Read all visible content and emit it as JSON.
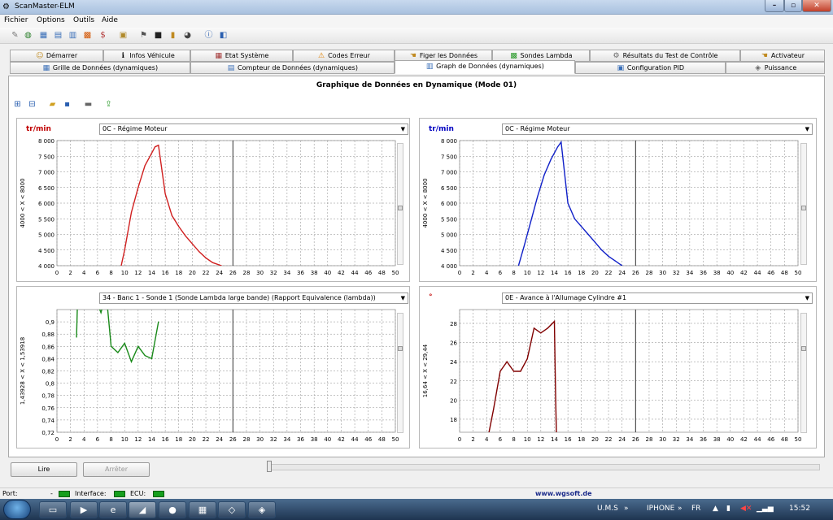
{
  "window": {
    "title": "ScanMaster-ELM",
    "min": "–",
    "max": "▫",
    "close": "✕"
  },
  "menu": [
    "Fichier",
    "Options",
    "Outils",
    "Aide"
  ],
  "tabs_row1": [
    "Démarrer",
    "Infos Véhicule",
    "Etat Système",
    "Codes Erreur",
    "Figer les Données",
    "Sondes Lambda",
    "Résultats du Test de Contrôle",
    "Activateur"
  ],
  "tabs_row2": [
    "Grille de Données (dynamiques)",
    "Compteur de Données (dynamiques)",
    "Graph de Données (dynamiques)",
    "Configuration PID",
    "Puissance"
  ],
  "panel_title": "Graphique de Données en Dynamique (Mode 01)",
  "charts": [
    {
      "unit": "tr/min",
      "pid": "0C - Régime Moteur",
      "range_label": "4000 < X < 8000",
      "color": "#d02020",
      "unit_color": "#c00000",
      "x": [
        9.5,
        10,
        11,
        12,
        13,
        14,
        14.5,
        15,
        16,
        17,
        18,
        19,
        20,
        21,
        22,
        23,
        24.3
      ],
      "y": [
        4000,
        4500,
        5700,
        6500,
        7200,
        7600,
        7800,
        7850,
        6300,
        5600,
        5250,
        4950,
        4700,
        4450,
        4250,
        4100,
        4000
      ]
    },
    {
      "unit": "tr/min",
      "pid": "0C - Régime Moteur",
      "range_label": "4000 < X < 8000",
      "color": "#1020c8",
      "unit_color": "#0000c0",
      "x": [
        8.7,
        9.5,
        10.5,
        11.5,
        12.5,
        13.5,
        14.5,
        15,
        16,
        17,
        18,
        19,
        20,
        21,
        22,
        23,
        24
      ],
      "y": [
        4000,
        4600,
        5400,
        6200,
        6900,
        7400,
        7800,
        7950,
        6000,
        5500,
        5250,
        5000,
        4750,
        4500,
        4300,
        4150,
        4000
      ]
    },
    {
      "unit": "",
      "pid": "34 - Banc 1 - Sonde 1 (Sonde Lambda large bande) (Rapport Equivalence (lambda))",
      "range_label": "1,43928 < X < 1,53918",
      "color": "#1a8a1a",
      "unit_color": "#000000",
      "x": [
        2.9,
        3,
        3.2,
        3.5,
        4,
        4.5,
        5,
        5.5,
        6,
        6.5,
        7,
        7.5,
        8,
        9,
        10,
        10.5,
        11,
        12,
        13,
        14,
        15
      ],
      "y": [
        0.875,
        0.92,
        0.96,
        0.96,
        0.965,
        0.97,
        0.965,
        0.96,
        0.93,
        0.915,
        0.935,
        0.92,
        0.86,
        0.85,
        0.865,
        0.85,
        0.835,
        0.86,
        0.845,
        0.84,
        0.9
      ]
    },
    {
      "unit": "°",
      "pid": "0E - Avance à l'Allumage Cylindre #1",
      "range_label": "16,64 < X < 29,44",
      "color": "#800000",
      "unit_color": "#c00000",
      "x": [
        4.3,
        5,
        6,
        7,
        7.5,
        8,
        9,
        10,
        11,
        12,
        13,
        14,
        14.1,
        14.2,
        14.3
      ],
      "y": [
        16.5,
        19,
        23,
        24,
        23.5,
        23,
        23,
        24.3,
        27.5,
        27,
        27.5,
        28.2,
        24,
        20,
        16.5
      ]
    }
  ],
  "axes": {
    "x_ticks": [
      "0",
      "2",
      "4",
      "6",
      "8",
      "10",
      "12",
      "14",
      "16",
      "18",
      "20",
      "22",
      "24",
      "26",
      "28",
      "30",
      "32",
      "34",
      "36",
      "38",
      "40",
      "42",
      "44",
      "46",
      "48",
      "50"
    ],
    "rpm_ticks": [
      "8 000",
      "7 500",
      "7 000",
      "6 500",
      "6 000",
      "5 500",
      "5 000",
      "4 500",
      "4 000"
    ],
    "lambda_ticks": [
      "0,9",
      "0,88",
      "0,86",
      "0,84",
      "0,82",
      "0,8",
      "0,78",
      "0,76",
      "0,74",
      "0,72"
    ],
    "advance_ticks": [
      "28",
      "26",
      "24",
      "22",
      "20",
      "18"
    ]
  },
  "buttons": {
    "read": "Lire",
    "stop": "Arrêter"
  },
  "status": {
    "port": "Port:",
    "interface": "Interface:",
    "ecu": "ECU:",
    "website": "www.wgsoft.de"
  },
  "taskbar": {
    "ums": "U.M.S",
    "iphone": "IPHONE",
    "lang": "FR",
    "clock": "15:52"
  }
}
